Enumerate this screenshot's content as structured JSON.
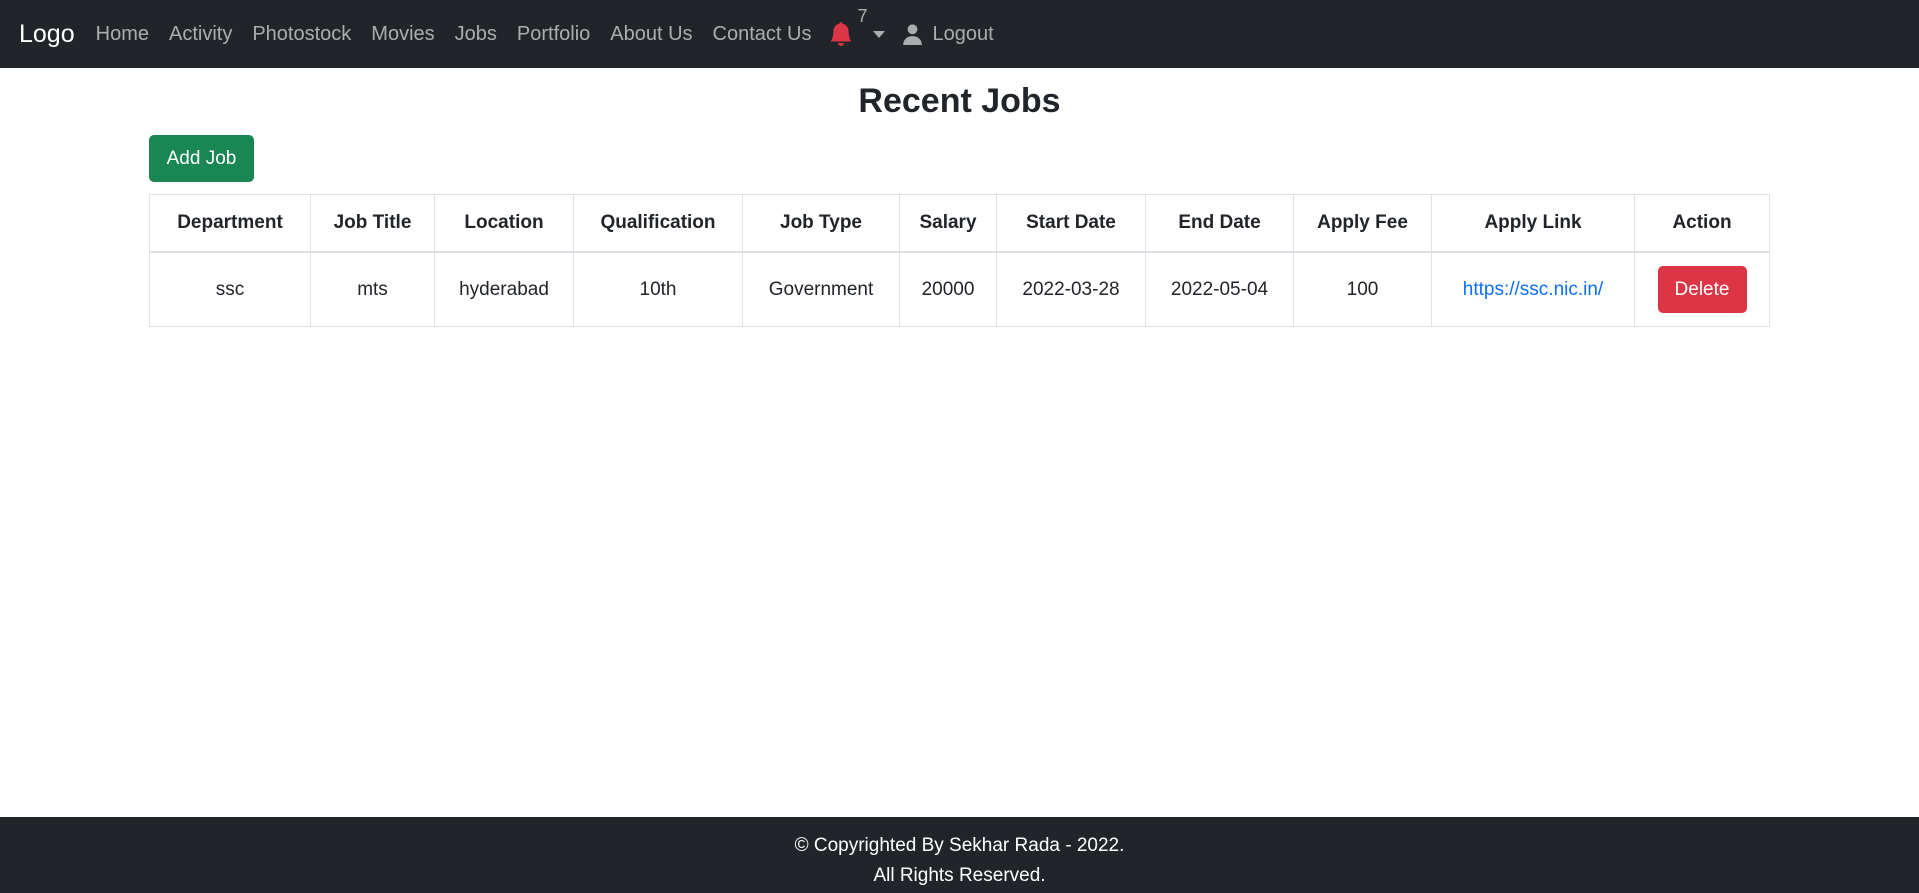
{
  "navbar": {
    "brand": "Logo",
    "links": [
      "Home",
      "Activity",
      "Photostock",
      "Movies",
      "Jobs",
      "Portfolio",
      "About Us",
      "Contact Us"
    ],
    "notification_count": "7",
    "notification_icon": "bell-icon",
    "notification_color": "#dc3545",
    "logout_label": "Logout",
    "logout_icon": "user-icon"
  },
  "main": {
    "title": "Recent Jobs",
    "add_button_label": "Add Job",
    "table": {
      "headers": [
        "Department",
        "Job Title",
        "Location",
        "Qualification",
        "Job Type",
        "Salary",
        "Start Date",
        "End Date",
        "Apply Fee",
        "Apply Link",
        "Action"
      ],
      "rows": [
        {
          "department": "ssc",
          "job_title": "mts",
          "location": "hyderabad",
          "qualification": "10th",
          "job_type": "Government",
          "salary": "20000",
          "start_date": "2022-03-28",
          "end_date": "2022-05-04",
          "apply_fee": "100",
          "apply_link": "https://ssc.nic.in/",
          "action_label": "Delete"
        }
      ]
    }
  },
  "footer": {
    "line1": "© Copyrighted By Sekhar Rada - 2022.",
    "line2": "All Rights Reserved."
  },
  "colors": {
    "navbar_bg": "#212529",
    "add_button": "#198754",
    "delete_button": "#dc3545",
    "link": "#0d6efd"
  }
}
